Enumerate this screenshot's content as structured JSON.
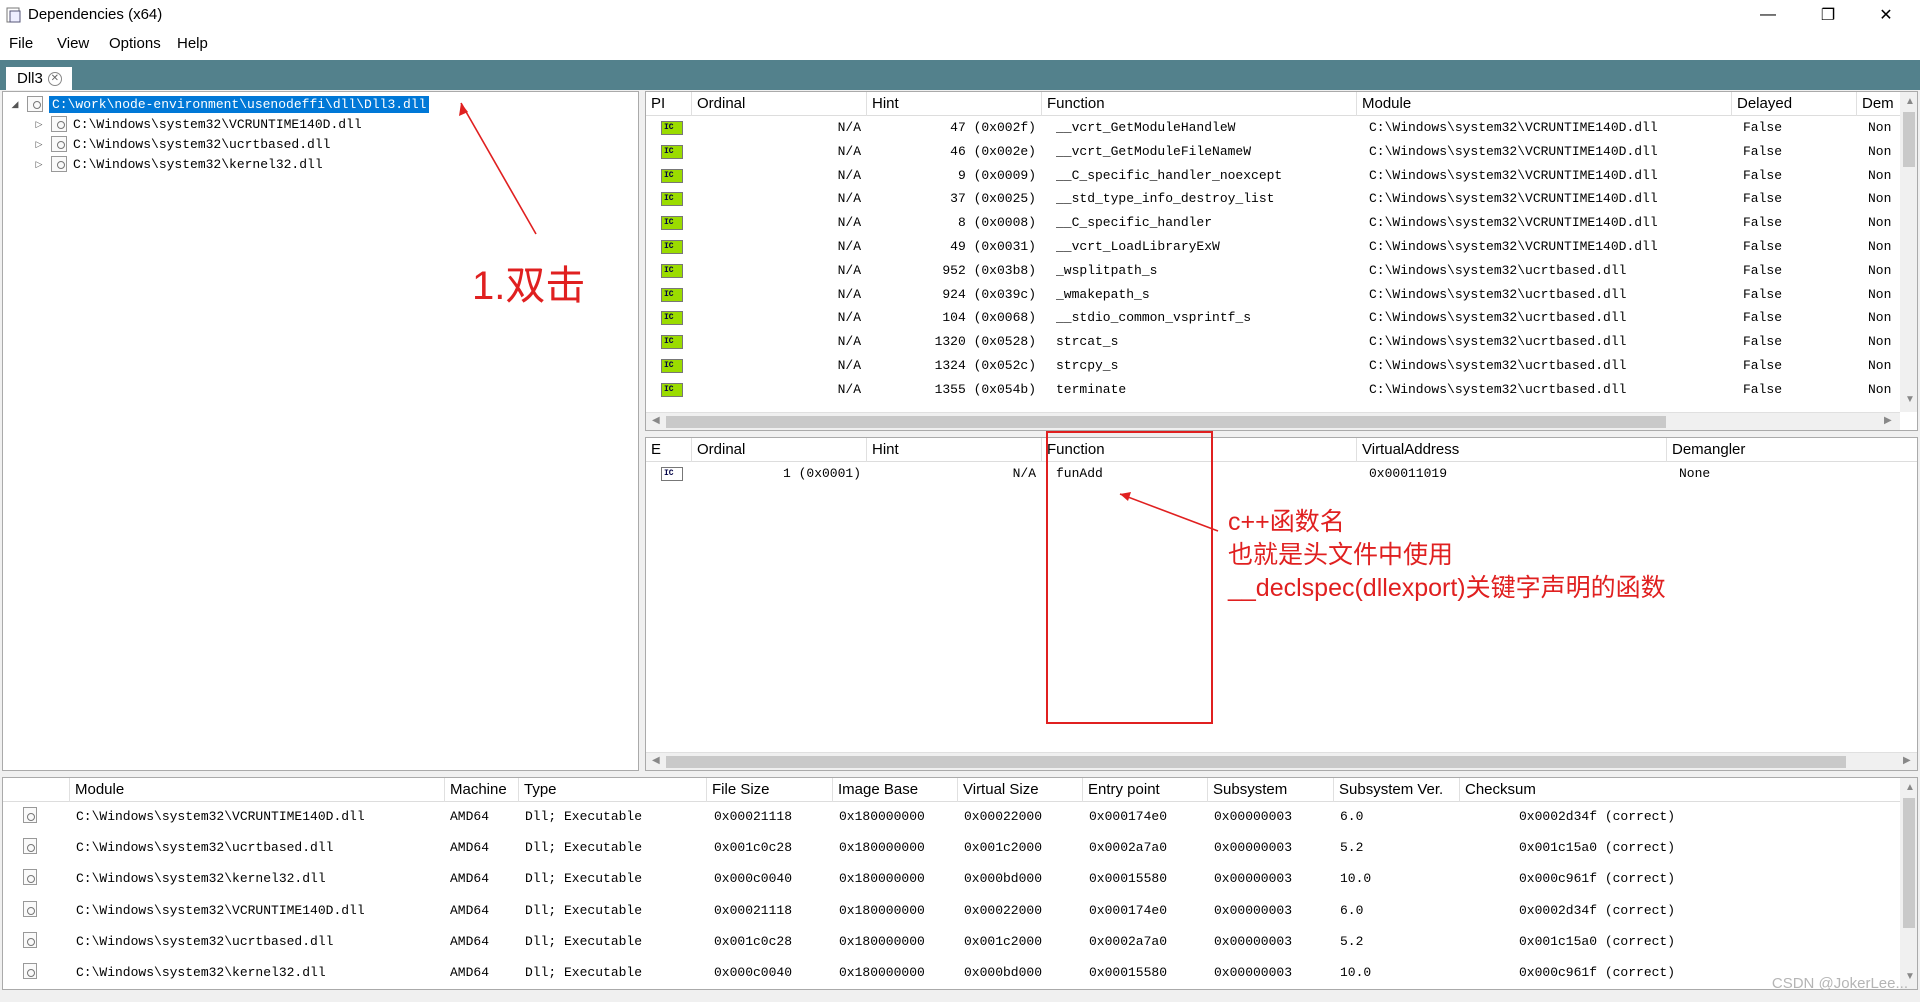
{
  "window": {
    "title": "Dependencies (x64)",
    "controls": [
      "—",
      "❐",
      "✕"
    ]
  },
  "menu": [
    "File",
    "View",
    "Options",
    "Help"
  ],
  "tab": {
    "label": "Dll3"
  },
  "tree": {
    "items": [
      {
        "label": "C:\\work\\node-environment\\usenodeffi\\dll\\Dll3.dll",
        "expander": "◢",
        "selected": true
      },
      {
        "label": "C:\\Windows\\system32\\VCRUNTIME140D.dll",
        "expander": "▷"
      },
      {
        "label": "C:\\Windows\\system32\\ucrtbased.dll",
        "expander": "▷"
      },
      {
        "label": "C:\\Windows\\system32\\kernel32.dll",
        "expander": "▷"
      }
    ]
  },
  "imports": {
    "headers": [
      "PI",
      "Ordinal",
      "Hint",
      "Function",
      "Module",
      "Delayed",
      "Dem"
    ],
    "rows": [
      {
        "icon": "IC",
        "ordinal": "N/A",
        "hint": "47 (0x002f)",
        "function": "__vcrt_GetModuleHandleW",
        "module": "C:\\Windows\\system32\\VCRUNTIME140D.dll",
        "delayed": "False",
        "dem": "Non"
      },
      {
        "icon": "IC",
        "ordinal": "N/A",
        "hint": "46 (0x002e)",
        "function": "__vcrt_GetModuleFileNameW",
        "module": "C:\\Windows\\system32\\VCRUNTIME140D.dll",
        "delayed": "False",
        "dem": "Non"
      },
      {
        "icon": "IC",
        "ordinal": "N/A",
        "hint": "9 (0x0009)",
        "function": "__C_specific_handler_noexcept",
        "module": "C:\\Windows\\system32\\VCRUNTIME140D.dll",
        "delayed": "False",
        "dem": "Non"
      },
      {
        "icon": "IC",
        "ordinal": "N/A",
        "hint": "37 (0x0025)",
        "function": "__std_type_info_destroy_list",
        "module": "C:\\Windows\\system32\\VCRUNTIME140D.dll",
        "delayed": "False",
        "dem": "Non"
      },
      {
        "icon": "IC",
        "ordinal": "N/A",
        "hint": "8 (0x0008)",
        "function": "__C_specific_handler",
        "module": "C:\\Windows\\system32\\VCRUNTIME140D.dll",
        "delayed": "False",
        "dem": "Non"
      },
      {
        "icon": "IC",
        "ordinal": "N/A",
        "hint": "49 (0x0031)",
        "function": "__vcrt_LoadLibraryExW",
        "module": "C:\\Windows\\system32\\VCRUNTIME140D.dll",
        "delayed": "False",
        "dem": "Non"
      },
      {
        "icon": "IC",
        "ordinal": "N/A",
        "hint": "952 (0x03b8)",
        "function": "_wsplitpath_s",
        "module": "C:\\Windows\\system32\\ucrtbased.dll",
        "delayed": "False",
        "dem": "Non"
      },
      {
        "icon": "IC",
        "ordinal": "N/A",
        "hint": "924 (0x039c)",
        "function": "_wmakepath_s",
        "module": "C:\\Windows\\system32\\ucrtbased.dll",
        "delayed": "False",
        "dem": "Non"
      },
      {
        "icon": "IC",
        "ordinal": "N/A",
        "hint": "104 (0x0068)",
        "function": "__stdio_common_vsprintf_s",
        "module": "C:\\Windows\\system32\\ucrtbased.dll",
        "delayed": "False",
        "dem": "Non"
      },
      {
        "icon": "IC",
        "ordinal": "N/A",
        "hint": "1320 (0x0528)",
        "function": "strcat_s",
        "module": "C:\\Windows\\system32\\ucrtbased.dll",
        "delayed": "False",
        "dem": "Non"
      },
      {
        "icon": "IC",
        "ordinal": "N/A",
        "hint": "1324 (0x052c)",
        "function": "strcpy_s",
        "module": "C:\\Windows\\system32\\ucrtbased.dll",
        "delayed": "False",
        "dem": "Non"
      },
      {
        "icon": "IC",
        "ordinal": "N/A",
        "hint": "1355 (0x054b)",
        "function": "terminate",
        "module": "C:\\Windows\\system32\\ucrtbased.dll",
        "delayed": "False",
        "dem": "Non"
      }
    ]
  },
  "exports": {
    "headers": [
      "E",
      "Ordinal",
      "Hint",
      "Function",
      "VirtualAddress",
      "Demangler"
    ],
    "rows": [
      {
        "icon": "IC",
        "ordinal": "1 (0x0001)",
        "hint": "N/A",
        "function": "funAdd",
        "address": "0x00011019",
        "demangler": "None"
      }
    ]
  },
  "modules": {
    "headers": [
      "Module",
      "Machine",
      "Type",
      "File Size",
      "Image Base",
      "Virtual Size",
      "Entry point",
      "Subsystem",
      "Subsystem Ver.",
      "Checksum"
    ],
    "rows": [
      {
        "module": "C:\\Windows\\system32\\VCRUNTIME140D.dll",
        "machine": "AMD64",
        "type": "Dll; Executable",
        "file_size": "0x00021118",
        "image_base": "0x180000000",
        "virtual_size": "0x00022000",
        "entry_point": "0x000174e0",
        "subsystem": "0x00000003",
        "subsystem_ver": "6.0",
        "checksum": "0x0002d34f (correct)"
      },
      {
        "module": "C:\\Windows\\system32\\ucrtbased.dll",
        "machine": "AMD64",
        "type": "Dll; Executable",
        "file_size": "0x001c0c28",
        "image_base": "0x180000000",
        "virtual_size": "0x001c2000",
        "entry_point": "0x0002a7a0",
        "subsystem": "0x00000003",
        "subsystem_ver": "5.2",
        "checksum": "0x001c15a0 (correct)"
      },
      {
        "module": "C:\\Windows\\system32\\kernel32.dll",
        "machine": "AMD64",
        "type": "Dll; Executable",
        "file_size": "0x000c0040",
        "image_base": "0x180000000",
        "virtual_size": "0x000bd000",
        "entry_point": "0x00015580",
        "subsystem": "0x00000003",
        "subsystem_ver": "10.0",
        "checksum": "0x000c961f (correct)"
      },
      {
        "module": "C:\\Windows\\system32\\VCRUNTIME140D.dll",
        "machine": "AMD64",
        "type": "Dll; Executable",
        "file_size": "0x00021118",
        "image_base": "0x180000000",
        "virtual_size": "0x00022000",
        "entry_point": "0x000174e0",
        "subsystem": "0x00000003",
        "subsystem_ver": "6.0",
        "checksum": "0x0002d34f (correct)"
      },
      {
        "module": "C:\\Windows\\system32\\ucrtbased.dll",
        "machine": "AMD64",
        "type": "Dll; Executable",
        "file_size": "0x001c0c28",
        "image_base": "0x180000000",
        "virtual_size": "0x001c2000",
        "entry_point": "0x0002a7a0",
        "subsystem": "0x00000003",
        "subsystem_ver": "5.2",
        "checksum": "0x001c15a0 (correct)"
      },
      {
        "module": "C:\\Windows\\system32\\kernel32.dll",
        "machine": "AMD64",
        "type": "Dll; Executable",
        "file_size": "0x000c0040",
        "image_base": "0x180000000",
        "virtual_size": "0x000bd000",
        "entry_point": "0x00015580",
        "subsystem": "0x00000003",
        "subsystem_ver": "10.0",
        "checksum": "0x000c961f (correct)"
      }
    ]
  },
  "annotations": {
    "double_click": "1.双击",
    "note_lines": [
      "c++函数名",
      "也就是头文件中使用",
      "__declspec(dllexport)关键字声明的函数"
    ]
  },
  "watermark": "CSDN @JokerLee...",
  "colors": {
    "accent": "#53818c",
    "selection": "#0078d7",
    "annotation": "#e02020",
    "import_badge": "#9bdc00"
  }
}
